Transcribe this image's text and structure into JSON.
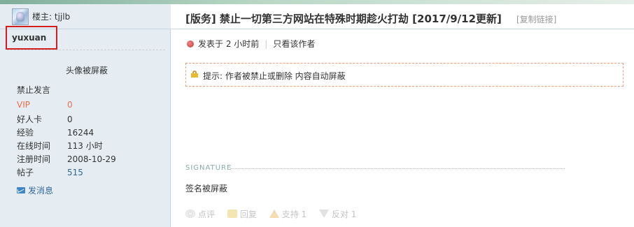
{
  "owner": {
    "label": "楼主: tjjlb"
  },
  "author": {
    "name": "yuxuan",
    "avatar_text": "头像被屏蔽",
    "status": "禁止发言",
    "stats": [
      {
        "key": "VIP",
        "value": "0"
      },
      {
        "key": "好人卡",
        "value": "0"
      },
      {
        "key": "经验",
        "value": "16244"
      },
      {
        "key": "在线时间",
        "value": "113 小时"
      },
      {
        "key": "注册时间",
        "value": "2008-10-29"
      },
      {
        "key": "帖子",
        "value": "515"
      }
    ],
    "message_link": "发消息"
  },
  "post": {
    "title": "[版务] 禁止一切第三方网站在特殊时期趁火打劫 [2017/9/12更新]",
    "copy_link": "[复制链接]",
    "posted": "发表于 2 小时前",
    "only_author": "只看该作者",
    "notice": "提示: 作者被禁止或删除 内容自动屏蔽",
    "signature_label": "SIGNATURE",
    "signature": "签名被屏蔽"
  },
  "actions": {
    "rate": "点评",
    "reply": "回复",
    "support": "支持 1",
    "oppose": "反对 1"
  },
  "colors": {
    "border": "#c2d5e3",
    "sidebar_bg": "#e5edf2",
    "vip": "#f26c4f",
    "link": "#336699",
    "highlight_box": "#d21e1e"
  }
}
